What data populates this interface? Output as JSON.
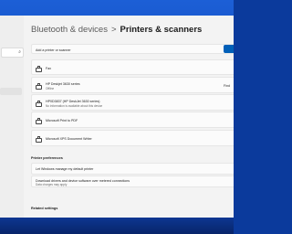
{
  "header": {
    "breadcrumb_parent": "Bluetooth & devices",
    "breadcrumb_sep": ">",
    "breadcrumb_current": "Printers & scanners"
  },
  "sidebar": {
    "search_icon": "⌕"
  },
  "add_device": {
    "label": "Add a printer or scanner",
    "find_label": "Find"
  },
  "printers": [
    {
      "name": "Fax",
      "status": ""
    },
    {
      "name": "HP Deskjet 3630 series",
      "status": "Offline"
    },
    {
      "name": "HP0D3837 (HP DeskJet 3630 series)",
      "status": "No information is available about this device"
    },
    {
      "name": "Microsoft Print to PDF",
      "status": ""
    },
    {
      "name": "Microsoft XPS Document Writer",
      "status": ""
    }
  ],
  "preferences": {
    "title": "Printer preferences",
    "items": [
      {
        "label": "Let Windows manage my default printer",
        "sub": ""
      },
      {
        "label": "Download drivers and device software over metered connections",
        "sub": "Data charges may apply"
      }
    ]
  },
  "related": {
    "title": "Related settings"
  },
  "colors": {
    "accent": "#005fb8",
    "window_bg": "#f3f3f3",
    "card_bg": "#fbfbfb",
    "desktop": "#1c5fd6"
  }
}
